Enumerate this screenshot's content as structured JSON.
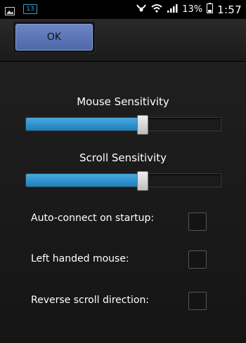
{
  "status_bar": {
    "notification_badge": "13",
    "battery_percent": "13%",
    "time": "1:57",
    "icons": [
      "image-icon",
      "notification-badge-icon",
      "sensitivity-icon",
      "wifi-icon",
      "signal-icon",
      "battery-icon"
    ]
  },
  "toolbar": {
    "ok_label": "OK"
  },
  "sliders": {
    "mouse": {
      "title": "Mouse Sensitivity",
      "value": 0.6
    },
    "scroll": {
      "title": "Scroll Sensitivity",
      "value": 0.6
    }
  },
  "options": [
    {
      "label": "Auto-connect on startup:",
      "checked": false
    },
    {
      "label": "Left handed mouse:",
      "checked": false
    },
    {
      "label": "Reverse scroll direction:",
      "checked": false
    }
  ],
  "colors": {
    "accent": "#2f8fd0",
    "ok_button": "#5a74b6"
  }
}
